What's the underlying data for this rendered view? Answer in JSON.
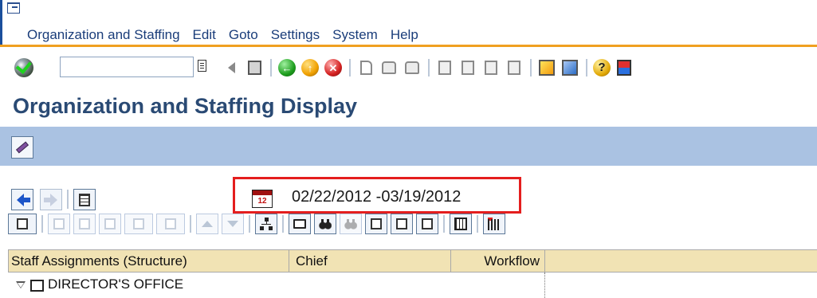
{
  "menu": {
    "items": [
      {
        "label": "Organization and Staffing"
      },
      {
        "label": "Edit"
      },
      {
        "label": "Goto"
      },
      {
        "label": "Settings"
      },
      {
        "label": "System"
      },
      {
        "label": "Help"
      }
    ]
  },
  "page": {
    "title": "Organization and Staffing Display"
  },
  "date_range": {
    "calendar_day": "12",
    "text": "02/22/2012 -03/19/2012"
  },
  "grid": {
    "columns": [
      {
        "label": "Staff Assignments (Structure)"
      },
      {
        "label": "Chief"
      },
      {
        "label": "Workflow"
      }
    ],
    "rows": [
      {
        "label": "DIRECTOR'S OFFICE"
      }
    ]
  },
  "colors": {
    "menu_accent": "#f0a020",
    "app_toolbar": "#aac2e2",
    "title_text": "#2a4a74",
    "highlight_box": "#e41e1e",
    "grid_header": "#f1e3b4"
  }
}
